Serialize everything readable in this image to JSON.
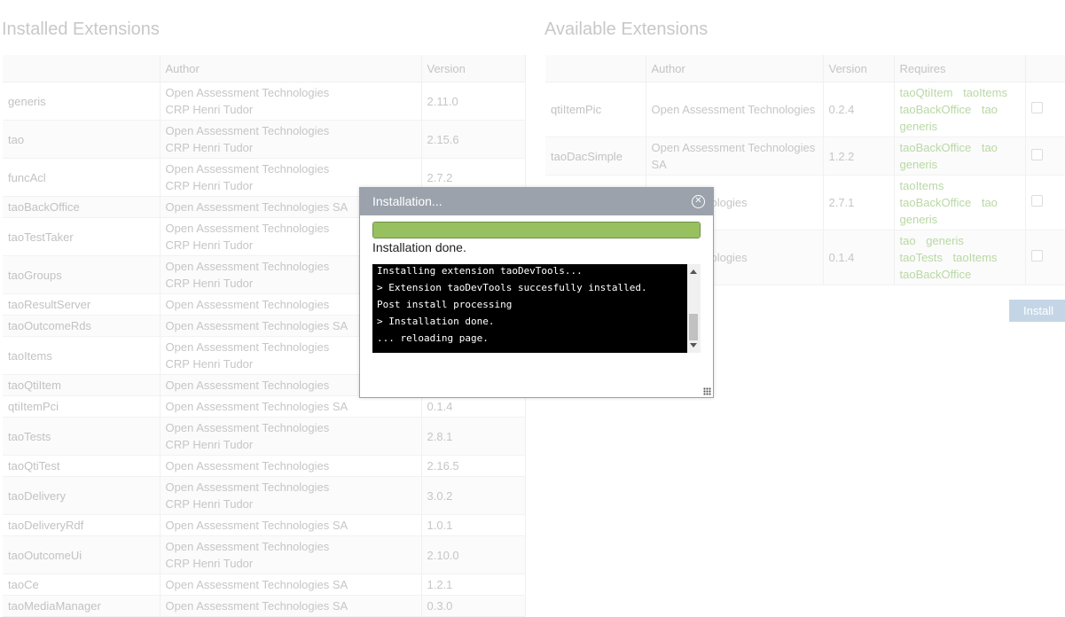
{
  "installed": {
    "title": "Installed Extensions",
    "headers": [
      "",
      "Author",
      "Version"
    ],
    "rows": [
      {
        "name": "generis",
        "author": [
          "Open Assessment Technologies",
          "CRP Henri Tudor"
        ],
        "version": "2.11.0"
      },
      {
        "name": "tao",
        "author": [
          "Open Assessment Technologies",
          "CRP Henri Tudor"
        ],
        "version": "2.15.6"
      },
      {
        "name": "funcAcl",
        "author": [
          "Open Assessment Technologies",
          "CRP Henri Tudor"
        ],
        "version": "2.7.2"
      },
      {
        "name": "taoBackOffice",
        "author": [
          "Open Assessment Technologies SA"
        ],
        "version": ""
      },
      {
        "name": "taoTestTaker",
        "author": [
          "Open Assessment Technologies",
          "CRP Henri Tudor"
        ],
        "version": ""
      },
      {
        "name": "taoGroups",
        "author": [
          "Open Assessment Technologies",
          "CRP Henri Tudor"
        ],
        "version": ""
      },
      {
        "name": "taoResultServer",
        "author": [
          "Open Assessment Technologies"
        ],
        "version": ""
      },
      {
        "name": "taoOutcomeRds",
        "author": [
          "Open Assessment Technologies SA"
        ],
        "version": ""
      },
      {
        "name": "taoItems",
        "author": [
          "Open Assessment Technologies",
          "CRP Henri Tudor"
        ],
        "version": ""
      },
      {
        "name": "taoQtiItem",
        "author": [
          "Open Assessment Technologies"
        ],
        "version": ""
      },
      {
        "name": "qtiItemPci",
        "author": [
          "Open Assessment Technologies SA"
        ],
        "version": "0.1.4"
      },
      {
        "name": "taoTests",
        "author": [
          "Open Assessment Technologies",
          "CRP Henri Tudor"
        ],
        "version": "2.8.1"
      },
      {
        "name": "taoQtiTest",
        "author": [
          "Open Assessment Technologies"
        ],
        "version": "2.16.5"
      },
      {
        "name": "taoDelivery",
        "author": [
          "Open Assessment Technologies",
          "CRP Henri Tudor"
        ],
        "version": "3.0.2"
      },
      {
        "name": "taoDeliveryRdf",
        "author": [
          "Open Assessment Technologies SA"
        ],
        "version": "1.0.1"
      },
      {
        "name": "taoOutcomeUi",
        "author": [
          "Open Assessment Technologies",
          "CRP Henri Tudor"
        ],
        "version": "2.10.0"
      },
      {
        "name": "taoCe",
        "author": [
          "Open Assessment Technologies SA"
        ],
        "version": "1.2.1"
      },
      {
        "name": "taoMediaManager",
        "author": [
          "Open Assessment Technologies SA"
        ],
        "version": "0.3.0"
      }
    ]
  },
  "available": {
    "title": "Available Extensions",
    "headers": [
      "",
      "Author",
      "Version",
      "Requires",
      ""
    ],
    "rows": [
      {
        "name": "qtiItemPic",
        "author": [
          "Open Assessment Technologies"
        ],
        "version": "0.2.4",
        "requires": [
          "taoQtiItem",
          "taoItems",
          "taoBackOffice",
          "tao",
          "generis"
        ]
      },
      {
        "name": "taoDacSimple",
        "author": [
          "Open Assessment Technologies",
          "SA"
        ],
        "version": "1.2.2",
        "requires": [
          "taoBackOffice",
          "tao",
          "generis"
        ]
      },
      {
        "name": "",
        "author": [
          "ment Technologies"
        ],
        "version": "2.7.1",
        "requires": [
          "taoItems",
          "taoBackOffice",
          "tao",
          "generis"
        ]
      },
      {
        "name": "",
        "author": [
          "ment Technologies"
        ],
        "version": "0.1.4",
        "requires": [
          "tao",
          "generis",
          "taoTests",
          "taoItems",
          "taoBackOffice"
        ]
      }
    ],
    "install_label": "Install"
  },
  "dialog": {
    "title": "Installation...",
    "progress": 1.0,
    "status": "Installation done.",
    "console_lines": [
      "Installing extension taoDevTools...",
      "> Extension taoDevTools succesfully installed.",
      "Post install processing",
      "> Installation done.",
      "... reloading page."
    ]
  },
  "icons": {
    "close": "close-circle-icon",
    "resize": "resize-grip-icon"
  },
  "colors": {
    "progress": "#97c05f",
    "header": "#9ba2ab",
    "requires_link": "#b9d8a4",
    "install_button": "#c4d6e6"
  }
}
